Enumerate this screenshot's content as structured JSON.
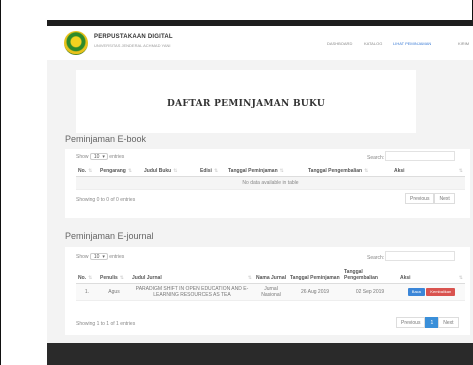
{
  "header": {
    "brand_title": "PERPUSTAKAAN DIGITAL",
    "brand_sub": "UNIVERSITAS JENDERAL ACHMAD YANI",
    "nav": [
      {
        "label": "DASHBOARD"
      },
      {
        "label": "KATALOG"
      },
      {
        "label": "LIHAT PEMINJAMAN"
      },
      {
        "label": "KIRIM"
      }
    ]
  },
  "page_title": "DAFTAR PEMINJAMAN BUKU",
  "ebook": {
    "section_title": "Peminjaman E-book",
    "show_prefix": "Show",
    "entries_value": "10",
    "show_suffix": "entries",
    "search_label": "Search:",
    "columns": [
      "No.",
      "Pengarang",
      "Judul Buku",
      "Edisi",
      "Tanggal Peminjaman",
      "Tanggal Pengembalian",
      "Aksi"
    ],
    "empty_text": "No data available in table",
    "info": "Showing 0 to 0 of 0 entries",
    "prev": "Previous",
    "next": "Next"
  },
  "ejournal": {
    "section_title": "Peminjaman E-journal",
    "show_prefix": "Show",
    "entries_value": "10",
    "show_suffix": "entries",
    "search_label": "Search:",
    "columns": [
      "No.",
      "Penulis",
      "Judul Jurnal",
      "Nama Jurnal",
      "Tanggal Peminjaman",
      "Tanggal Pengembalian",
      "Aksi"
    ],
    "rows": [
      {
        "no": "1.",
        "penulis": "Agus",
        "judul": "PARADIGM SHIFT IN OPEN EDUCATION AND E-LEARNING RESOURCES AS TEA",
        "nama_jurnal": "Jurnal Nasional",
        "tgl_pinjam": "26 Aug 2019",
        "tgl_kembali": "02 Sep 2019",
        "btn_read": "Baca",
        "btn_return": "Kembalikan"
      }
    ],
    "info": "Showing 1 to 1 of 1 entries",
    "prev": "Previous",
    "page": "1",
    "next": "Next"
  }
}
